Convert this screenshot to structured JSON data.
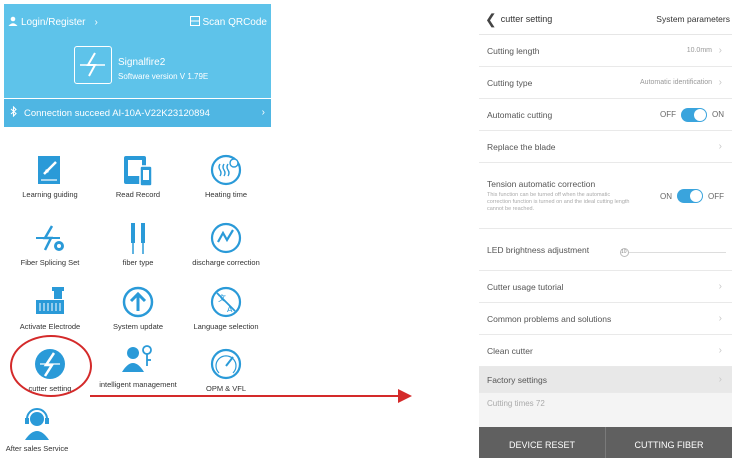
{
  "left": {
    "header": {
      "login": "Login/Register",
      "scan": "Scan QRCode",
      "device_name": "Signalfire2",
      "software_version": "Software version  V 1.79E"
    },
    "connection": "Connection succeed AI-10A-V22K23120894",
    "grid": [
      {
        "label": "Learning guiding",
        "icon": "learning-icon"
      },
      {
        "label": "Read Record",
        "icon": "record-icon"
      },
      {
        "label": "Heating time",
        "icon": "heating-icon"
      },
      {
        "label": "Fiber Splicing Set",
        "icon": "splicing-icon"
      },
      {
        "label": "fiber type",
        "icon": "fiber-icon"
      },
      {
        "label": "discharge correction",
        "icon": "discharge-icon"
      },
      {
        "label": "Activate Electrode",
        "icon": "electrode-icon"
      },
      {
        "label": "System update",
        "icon": "update-icon"
      },
      {
        "label": "Language selection",
        "icon": "language-icon"
      },
      {
        "label": "cutter setting",
        "icon": "cutter-icon"
      },
      {
        "label": "intelligent management",
        "icon": "management-icon"
      },
      {
        "label": "OPM & VFL",
        "icon": "opm-icon"
      },
      {
        "label": "After sales Service",
        "icon": "service-icon"
      }
    ]
  },
  "right": {
    "topbar": {
      "title": "cutter setting",
      "system_parameters": "System parameters"
    },
    "cutting_length": {
      "label": "Cutting length",
      "value": "10.0mm"
    },
    "cutting_type": {
      "label": "Cutting type",
      "value": "Automatic identification"
    },
    "automatic_cutting": {
      "label": "Automatic cutting",
      "off": "OFF",
      "on": "ON"
    },
    "replace_blade": {
      "label": "Replace the blade"
    },
    "tension": {
      "label": "Tension automatic correction",
      "desc": "This function can be turned off when the automatic correction function is turned on and the ideal cutting length cannot be reached.",
      "on": "ON",
      "off": "OFF"
    },
    "led": {
      "label": "LED brightness adjustment",
      "value": "10"
    },
    "tutorial": {
      "label": "Cutter usage tutorial"
    },
    "problems": {
      "label": "Common problems and solutions"
    },
    "clean": {
      "label": "Clean cutter"
    },
    "factory": {
      "label": "Factory settings"
    },
    "cutting_times": "Cutting times 72",
    "buttons": {
      "reset": "DEVICE RESET",
      "cutting": "CUTTING FIBER"
    }
  }
}
